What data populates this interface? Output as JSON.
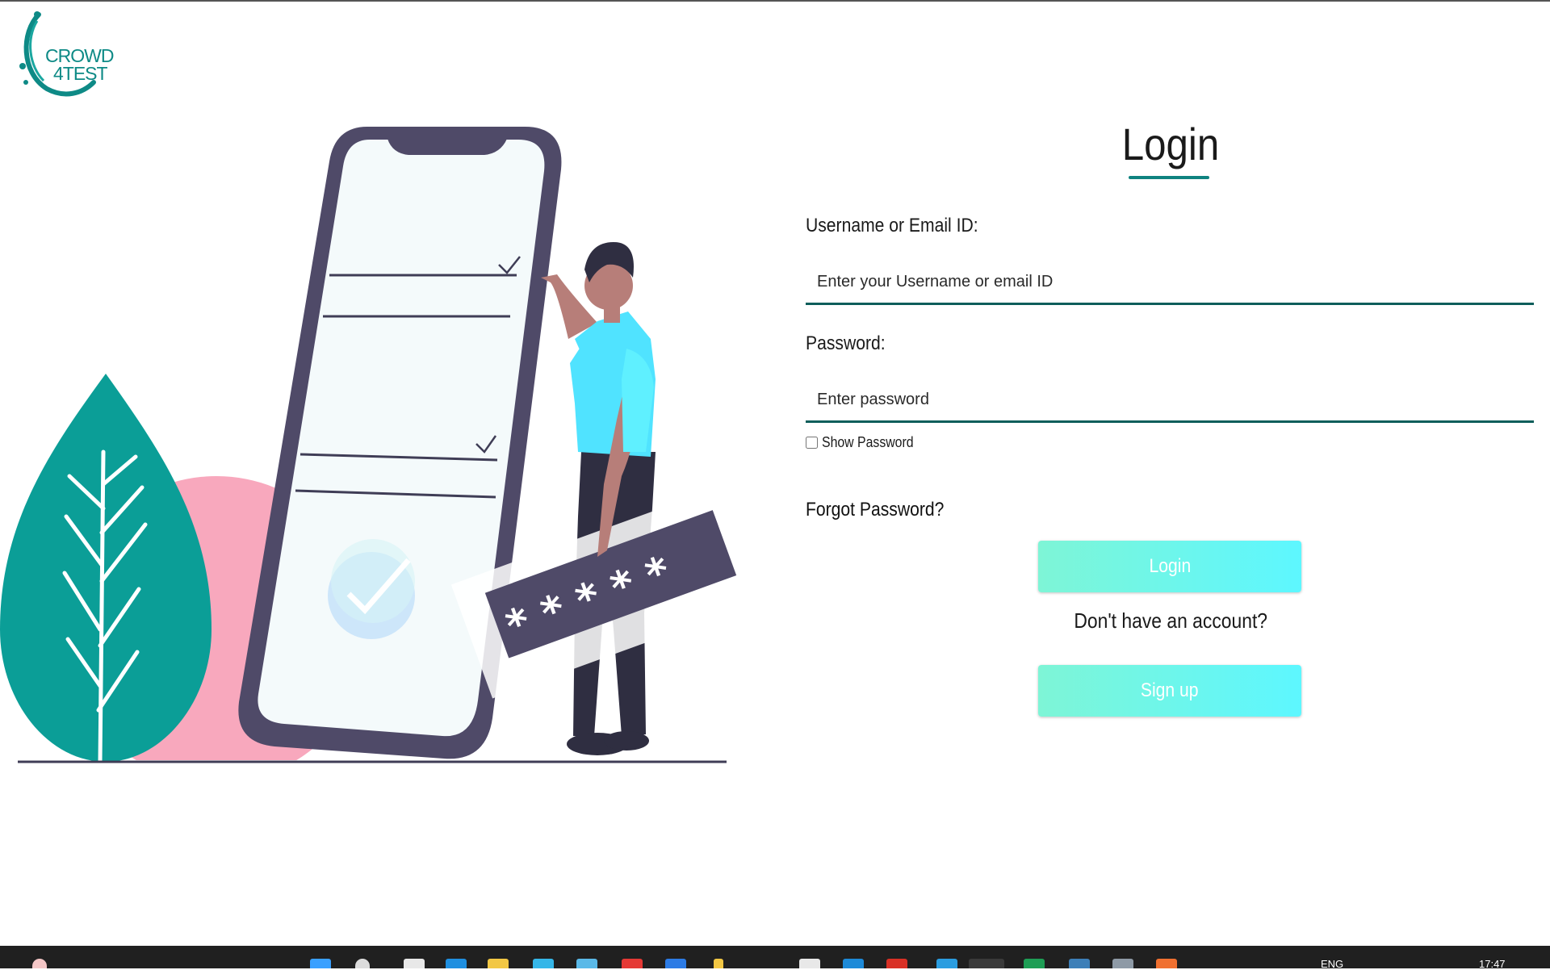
{
  "brand": {
    "line1": "CROWD",
    "line2": "4TEST"
  },
  "login": {
    "title": "Login",
    "username_label": "Username or Email ID:",
    "username_placeholder": "Enter your Username or email ID",
    "password_label": "Password:",
    "password_placeholder": "Enter password",
    "show_password_label": "Show Password",
    "forgot_password": "Forgot Password?",
    "login_button": "Login",
    "no_account_text": "Don't have an account?",
    "signup_button": "Sign up"
  },
  "taskbar": {
    "language": "ENG",
    "time": "17:47",
    "apps": [
      "start-icon",
      "search-icon",
      "task-view-icon",
      "edge-icon",
      "file-explorer-icon",
      "chrome-icon",
      "phone-link-icon",
      "app-icon",
      "store-icon",
      "files-icon",
      "notes-icon",
      "skype-icon",
      "mail-icon",
      "app-icon",
      "app-icon",
      "excel-icon",
      "app-icon",
      "app-icon",
      "app-icon"
    ]
  },
  "colors": {
    "accent": "#0f8380",
    "button_gradient_start": "#7ef5d6",
    "button_gradient_end": "#5df7ff",
    "leaf": "#0b9e97",
    "blob": "#f8a8bd",
    "phone_frame": "#4f4a68",
    "shirt": "#50e3ff"
  }
}
